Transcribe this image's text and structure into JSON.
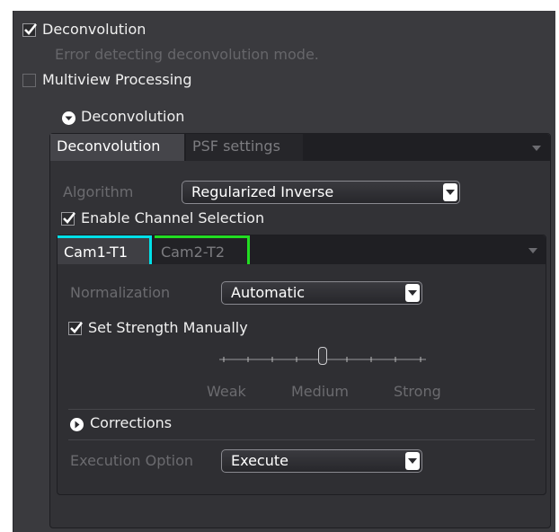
{
  "deconvolution_option": {
    "label": "Deconvolution",
    "checked": true,
    "error": "Error detecting deconvolution mode."
  },
  "multiview_option": {
    "label": "Multiview Processing",
    "checked": false
  },
  "section": {
    "title": "Deconvolution",
    "expanded": true
  },
  "main_tabs": [
    {
      "label": "Deconvolution",
      "active": true
    },
    {
      "label": "PSF settings",
      "active": false
    }
  ],
  "algorithm": {
    "label": "Algorithm",
    "value": "Regularized Inverse"
  },
  "enable_channel_selection": {
    "label": "Enable Channel Selection",
    "checked": true
  },
  "channel_tabs": [
    {
      "label": "Cam1-T1",
      "color": "#00e0e8",
      "active": true
    },
    {
      "label": "Cam2-T2",
      "color": "#22dd22",
      "active": false
    }
  ],
  "normalization": {
    "label": "Normalization",
    "value": "Automatic"
  },
  "set_strength": {
    "label": "Set Strength Manually",
    "checked": true
  },
  "strength_slider": {
    "labels": [
      "Weak",
      "Medium",
      "Strong"
    ],
    "value_fraction": 0.5
  },
  "corrections": {
    "label": "Corrections",
    "expanded": false
  },
  "execution": {
    "label": "Execution Option",
    "value": "Execute"
  },
  "colors": {
    "background": "#3a3a3e",
    "panel": "#323236",
    "text": "#f0f0f0",
    "disabled_text": "#6b6b6f"
  }
}
